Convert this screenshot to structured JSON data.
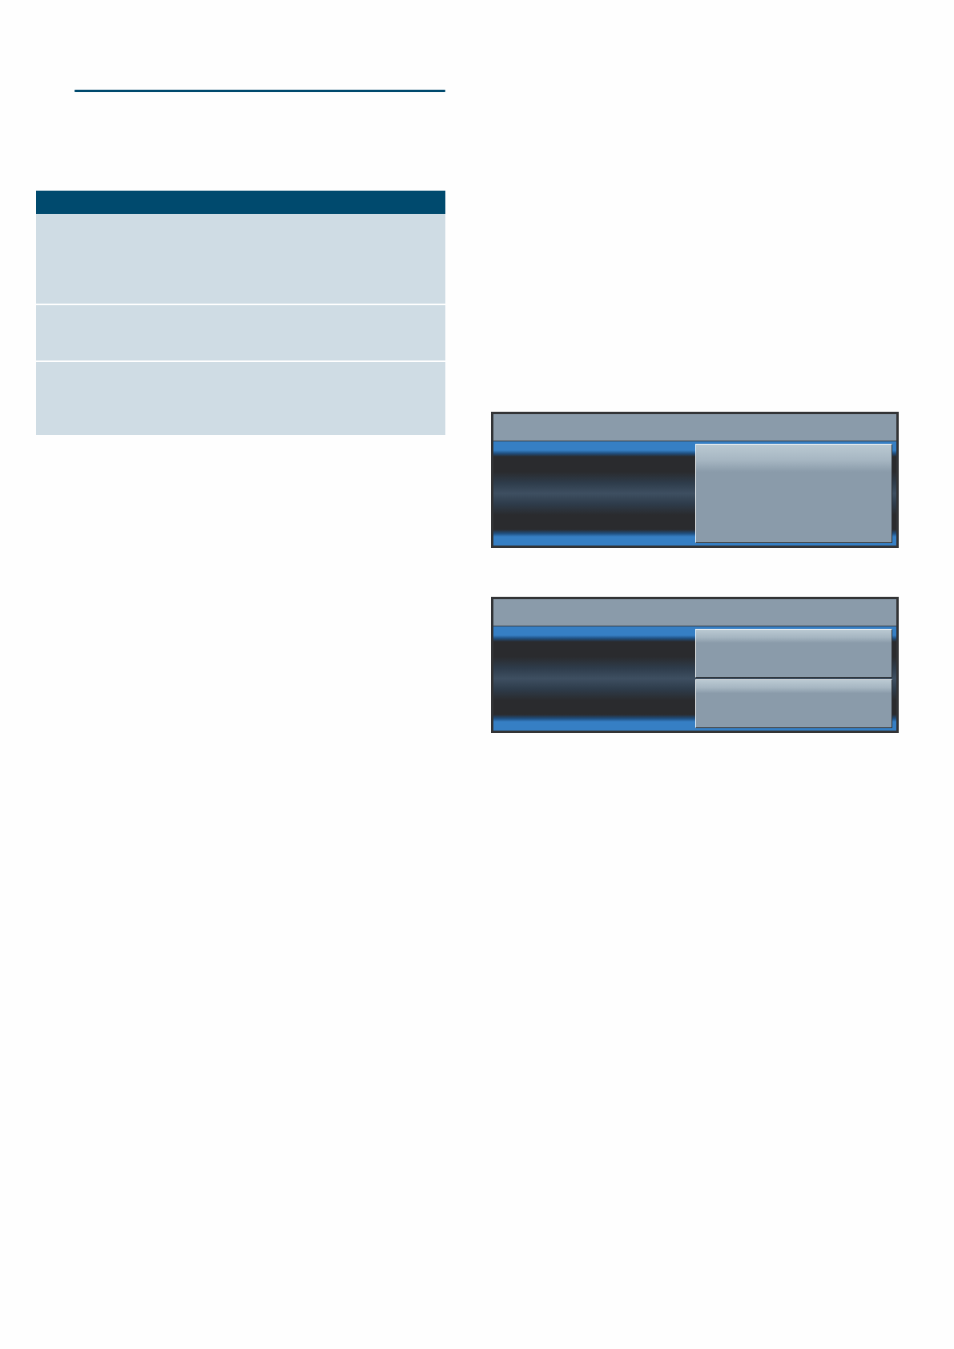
{
  "table": {
    "rows": [
      {},
      {},
      {}
    ]
  },
  "screens": [
    {
      "options": [
        {
          "kind": "button"
        }
      ]
    },
    {
      "options": [
        {
          "kind": "button"
        },
        {
          "kind": "button"
        }
      ]
    }
  ]
}
